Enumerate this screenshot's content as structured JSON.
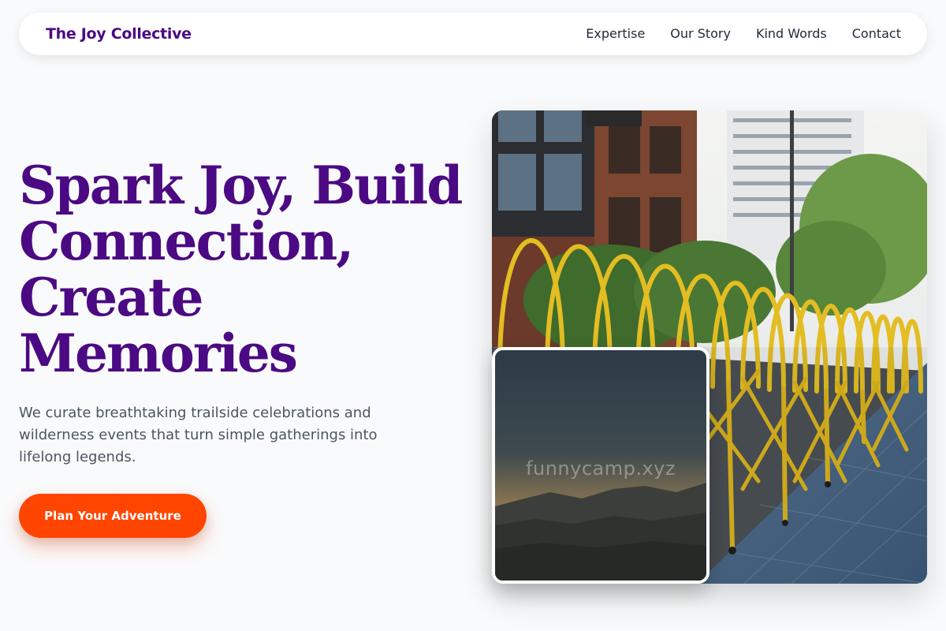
{
  "brand": {
    "name": "The Joy Collective"
  },
  "nav": {
    "links": [
      "Expertise",
      "Our Story",
      "Kind Words",
      "Contact"
    ]
  },
  "hero": {
    "title_lines": [
      "Spark Joy, Build",
      "Connection,",
      "Create",
      "Memories"
    ],
    "subtitle": "We curate breathtaking trailside celebrations and wilderness events that turn simple gatherings into lifelong legends.",
    "cta_label": "Plan Your Adventure"
  },
  "images": {
    "main": {
      "subject": "yellow folding barrier in front of city buildings"
    },
    "inset": {
      "subject": "mountain ridge at dusk",
      "watermark": "funnycamp.xyz"
    }
  },
  "colors": {
    "brand_purple": "#4b0a83",
    "cta_orange": "#ff4500",
    "body_text": "#4b5563",
    "background": "#f9fafb"
  }
}
